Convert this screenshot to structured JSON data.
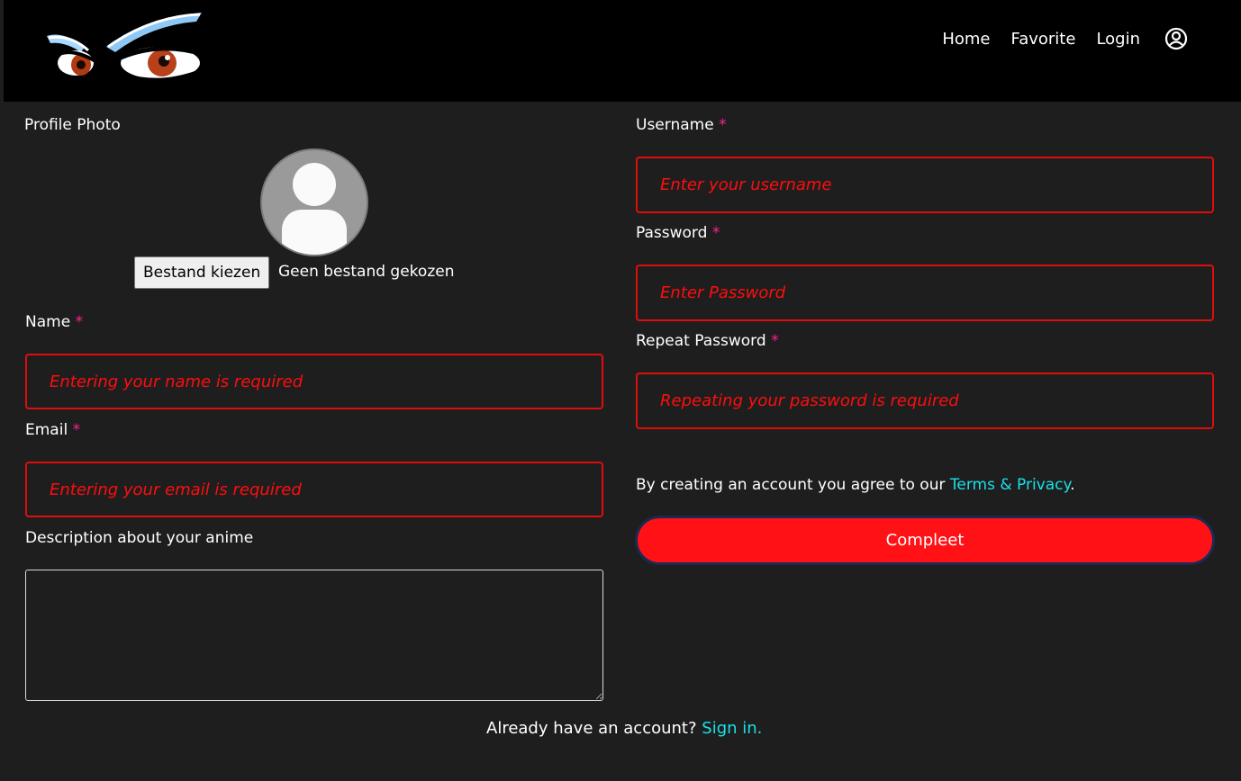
{
  "nav": {
    "home": "Home",
    "favorite": "Favorite",
    "login": "Login"
  },
  "profile": {
    "label": "Profile Photo",
    "file_button": "Bestand kiezen",
    "file_status": "Geen bestand gekozen"
  },
  "name": {
    "label": "Name",
    "required": "*",
    "placeholder": "Entering your name is required"
  },
  "email": {
    "label": "Email",
    "required": "*",
    "placeholder": "Entering your email is required"
  },
  "description": {
    "label": "Description about your anime"
  },
  "username": {
    "label": "Username",
    "required": "*",
    "placeholder": "Enter your username"
  },
  "password": {
    "label": "Password",
    "required": "*",
    "placeholder": "Enter Password"
  },
  "repeat_password": {
    "label": "Repeat Password",
    "required": "*",
    "placeholder": "Repeating your password is required"
  },
  "terms": {
    "prefix": "By creating an account you agree to our ",
    "link": "Terms & Privacy",
    "suffix": "."
  },
  "submit": {
    "label": "Compleet"
  },
  "signin": {
    "prefix": "Already have an account? ",
    "link": "Sign in."
  },
  "colors": {
    "accent_red": "#ff1115",
    "link_cyan": "#19e0e8",
    "required_pink": "#ff1f8f",
    "background": "#1e1e1e"
  },
  "icons": {
    "logo": "anime-eyes-logo",
    "user": "user-circle-icon",
    "avatar": "default-avatar-icon"
  }
}
